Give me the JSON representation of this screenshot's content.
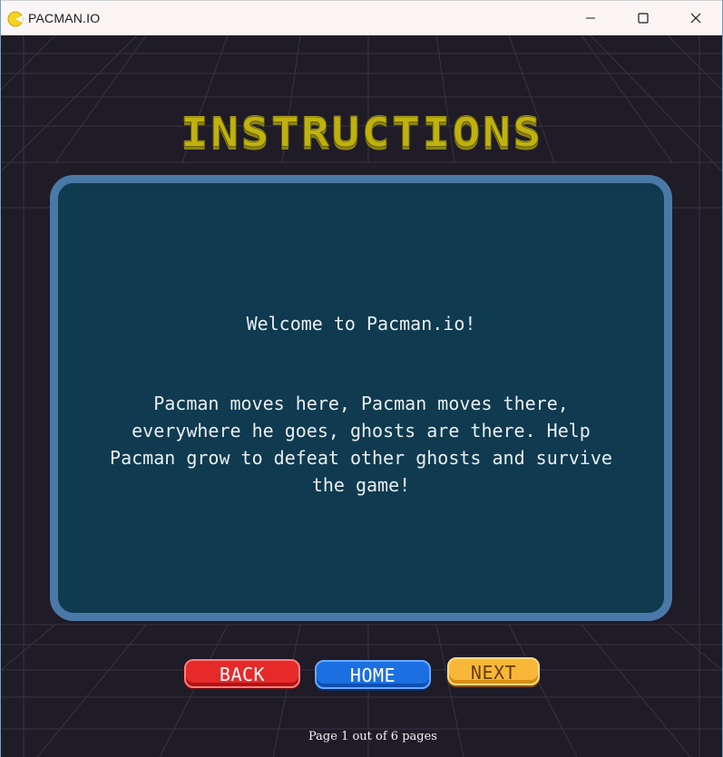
{
  "window": {
    "title": "PACMAN.IO",
    "controls": {
      "minimize": "minimize-icon",
      "maximize": "maximize-icon",
      "close": "close-icon"
    }
  },
  "screen": {
    "heading": "INSTRUCTIONS",
    "panel": {
      "welcome": "Welcome to Pacman.io!",
      "body": "Pacman moves here, Pacman moves there, everywhere he goes, ghosts are there. Help Pacman grow to defeat other ghosts and survive the game!"
    },
    "buttons": {
      "back": "BACK",
      "home": "HOME",
      "next": "NEXT"
    },
    "page_indicator": "Page 1 out of 6 pages"
  },
  "colors": {
    "background": "#1f1b27",
    "heading": "#bfb20e",
    "panel_fill": "#0f3a4f",
    "panel_border": "#4a79a8",
    "back_button": "#e62a2a",
    "home_button": "#1b6fe0",
    "next_button": "#f7b83a"
  }
}
